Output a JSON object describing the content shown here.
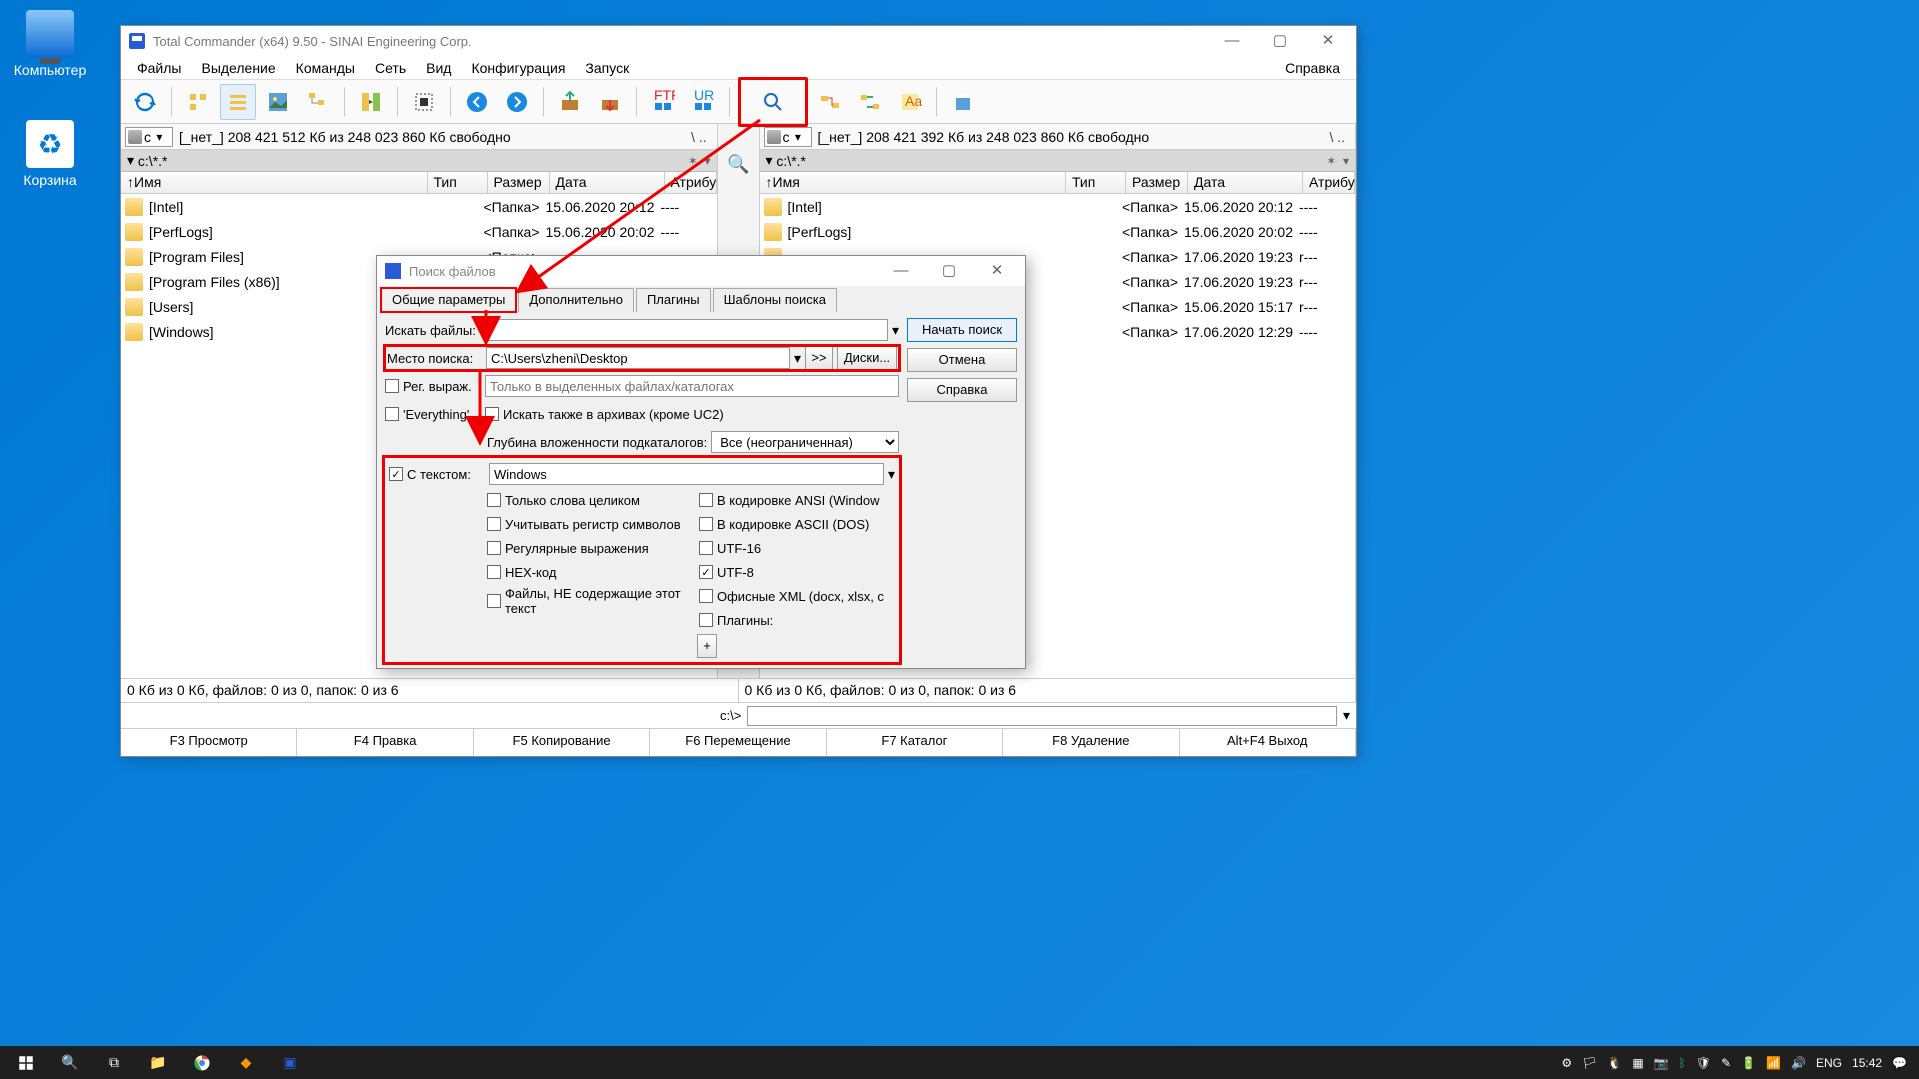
{
  "desktop": {
    "computer": "Компьютер",
    "trash": "Корзина"
  },
  "tc": {
    "title": "Total Commander (x64) 9.50 - SINAI Engineering Corp.",
    "menu": [
      "Файлы",
      "Выделение",
      "Команды",
      "Сеть",
      "Вид",
      "Конфигурация",
      "Запуск"
    ],
    "help": "Справка",
    "drive_label": "c",
    "drive_info_l": "[_нет_]  208 421 512 Кб из 248 023 860 Кб свободно",
    "drive_info_r": "[_нет_]  208 421 392 Кб из 248 023 860 Кб свободно",
    "root_sym": "\\  ..",
    "path": "c:\\*.*",
    "headers": {
      "name": "↑Имя",
      "ext": "Тип",
      "size": "Размер",
      "date": "Дата",
      "attr": "Атрибу"
    },
    "files_l": [
      {
        "name": "[Intel]",
        "size": "<Папка>",
        "date": "15.06.2020 20:12",
        "attr": "----"
      },
      {
        "name": "[PerfLogs]",
        "size": "<Папка>",
        "date": "15.06.2020 20:02",
        "attr": "----"
      },
      {
        "name": "[Program Files]",
        "size": "<Папка>",
        "date": "",
        "attr": ""
      },
      {
        "name": "[Program Files (x86)]",
        "size": "",
        "date": "",
        "attr": ""
      },
      {
        "name": "[Users]",
        "size": "",
        "date": "",
        "attr": ""
      },
      {
        "name": "[Windows]",
        "size": "",
        "date": "",
        "attr": ""
      }
    ],
    "files_r": [
      {
        "name": "[Intel]",
        "size": "<Папка>",
        "date": "15.06.2020 20:12",
        "attr": "----"
      },
      {
        "name": "[PerfLogs]",
        "size": "<Папка>",
        "date": "15.06.2020 20:02",
        "attr": "----"
      },
      {
        "name": "",
        "size": "<Папка>",
        "date": "17.06.2020 19:23",
        "attr": "r---"
      },
      {
        "name": "",
        "size": "<Папка>",
        "date": "17.06.2020 19:23",
        "attr": "r---"
      },
      {
        "name": "",
        "size": "<Папка>",
        "date": "15.06.2020 15:17",
        "attr": "r---"
      },
      {
        "name": "",
        "size": "<Папка>",
        "date": "17.06.2020 12:29",
        "attr": "----"
      }
    ],
    "status_l": "0 Кб из 0 Кб, файлов: 0 из 0, папок: 0 из 6",
    "status_r": "0 Кб из 0 Кб, файлов: 0 из 0, папок: 0 из 6",
    "prompt": "c:\\>",
    "fnkeys": [
      "F3 Просмотр",
      "F4 Правка",
      "F5 Копирование",
      "F6 Перемещение",
      "F7 Каталог",
      "F8 Удаление",
      "Alt+F4 Выход"
    ]
  },
  "dlg": {
    "title": "Поиск файлов",
    "tabs": [
      "Общие параметры",
      "Дополнительно",
      "Плагины",
      "Шаблоны поиска"
    ],
    "lbl_search": "Искать файлы:",
    "lbl_location": "Место поиска:",
    "location": "C:\\Users\\zheni\\Desktop",
    "btn_expand": ">>",
    "btn_drives": "Диски...",
    "cb_regex": "Рег. выраж.",
    "cb_everything": "'Everything'",
    "ph_selected": "Только в выделенных файлах/каталогах",
    "cb_archives": "Искать также в архивах (кроме UC2)",
    "lbl_depth": "Глубина вложенности подкаталогов:",
    "depth_val": "Все (неограниченная)",
    "cb_withtext": "С текстом:",
    "text_val": "Windows",
    "opts_l": [
      "Только слова целиком",
      "Учитывать регистр символов",
      "Регулярные выражения",
      "HEX-код",
      "Файлы, НЕ содержащие этот текст"
    ],
    "opts_r": [
      "В кодировке ANSI (Window",
      "В кодировке ASCII (DOS)",
      "UTF-16",
      "UTF-8",
      "Офисные XML (docx, xlsx, c",
      "Плагины:"
    ],
    "opts_r_checked": [
      false,
      false,
      false,
      true,
      false,
      false
    ],
    "btn_plus": "+",
    "btn_start": "Начать поиск",
    "btn_cancel": "Отмена",
    "btn_help": "Справка"
  },
  "tray": {
    "lang": "ENG",
    "time": "15:42"
  }
}
